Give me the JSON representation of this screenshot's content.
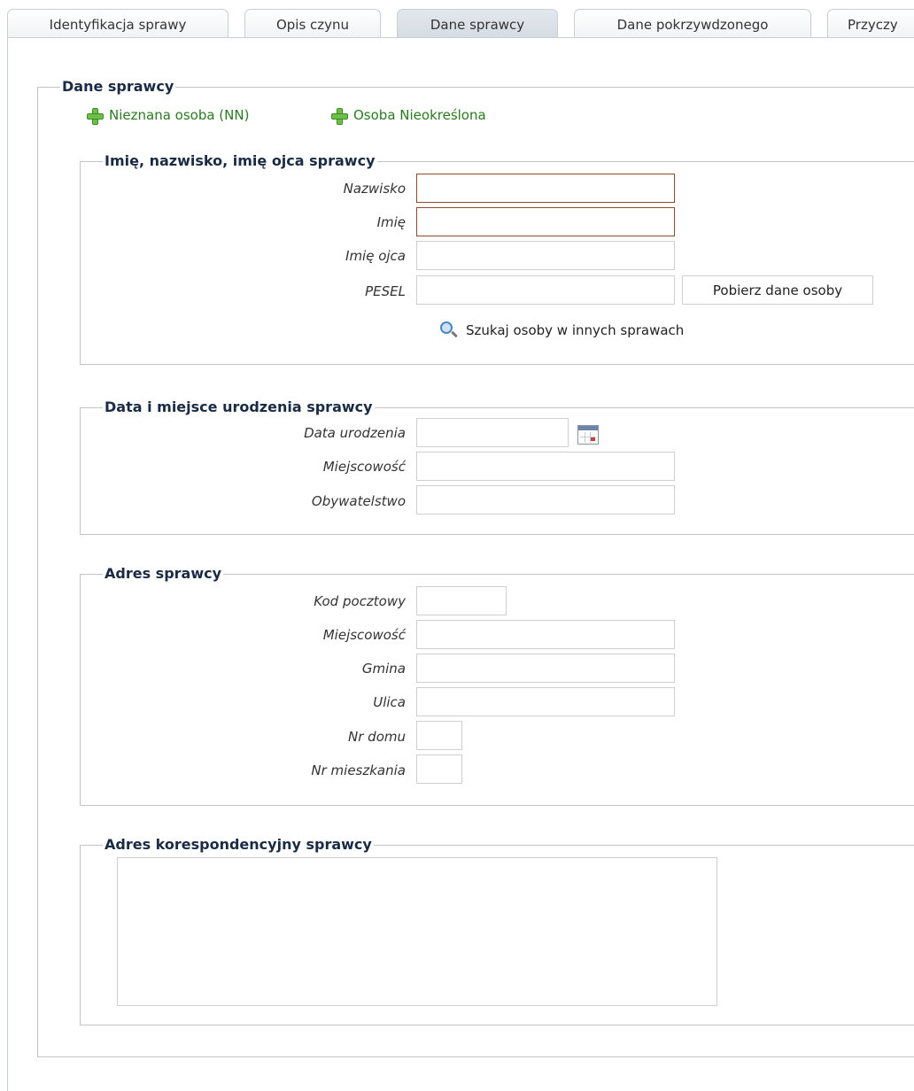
{
  "tabs": [
    {
      "label": "Identyfikacja sprawy",
      "active": false
    },
    {
      "label": "Opis czynu",
      "active": false
    },
    {
      "label": "Dane sprawcy",
      "active": true
    },
    {
      "label": "Dane pokrzywdzonego",
      "active": false
    },
    {
      "label": "Przyczy",
      "active": false
    }
  ],
  "main": {
    "legend": "Dane sprawcy",
    "links": {
      "unknown_person": "Nieznana osoba (NN)",
      "unspecified_person": "Osoba Nieokreślona"
    }
  },
  "name_section": {
    "legend": "Imię, nazwisko, imię ojca sprawcy",
    "surname_label": "Nazwisko",
    "first_name_label": "Imię",
    "father_name_label": "Imię ojca",
    "pesel_label": "PESEL",
    "fetch_button": "Pobierz dane osoby",
    "search_link": "Szukaj osoby w innych sprawach"
  },
  "birth_section": {
    "legend": "Data i miejsce urodzenia sprawcy",
    "birth_date_label": "Data urodzenia",
    "city_label": "Miejscowość",
    "citizenship_label": "Obywatelstwo"
  },
  "address_section": {
    "legend": "Adres sprawcy",
    "postal_label": "Kod pocztowy",
    "city_label": "Miejscowość",
    "commune_label": "Gmina",
    "street_label": "Ulica",
    "house_label": "Nr domu",
    "apartment_label": "Nr mieszkania"
  },
  "correspondence_section": {
    "legend": "Adres korespondencyjny sprawcy"
  },
  "colors": {
    "link_green": "#2a7a1f",
    "required_border": "#8a4a2a",
    "legend_navy": "#1a2b45"
  }
}
